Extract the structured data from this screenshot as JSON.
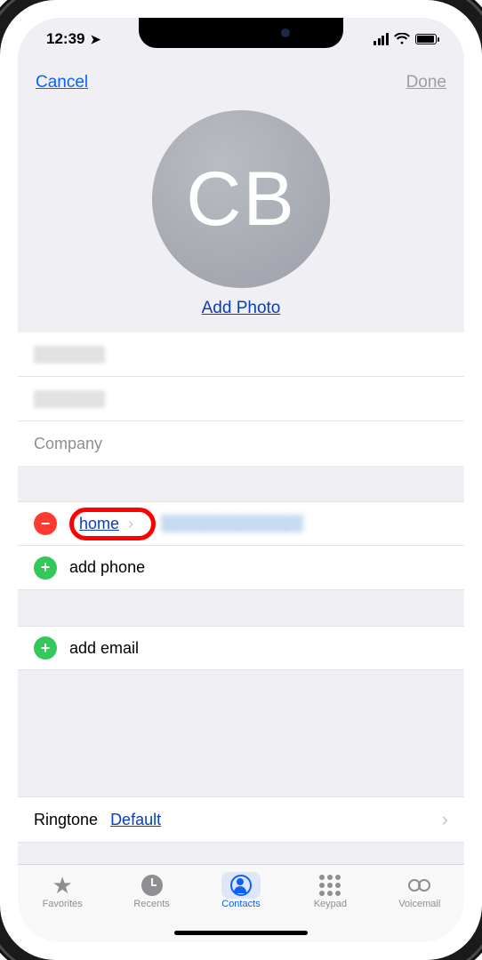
{
  "status": {
    "time": "12:39"
  },
  "nav": {
    "cancel": "Cancel",
    "done": "Done"
  },
  "avatar": {
    "initials": "CB",
    "add_photo": "Add Photo"
  },
  "fields": {
    "company_placeholder": "Company"
  },
  "phone": {
    "label": "home",
    "add_label": "add phone"
  },
  "email": {
    "add_label": "add email"
  },
  "ringtone": {
    "label": "Ringtone",
    "value": "Default"
  },
  "tabs": {
    "favorites": "Favorites",
    "recents": "Recents",
    "contacts": "Contacts",
    "keypad": "Keypad",
    "voicemail": "Voicemail"
  }
}
